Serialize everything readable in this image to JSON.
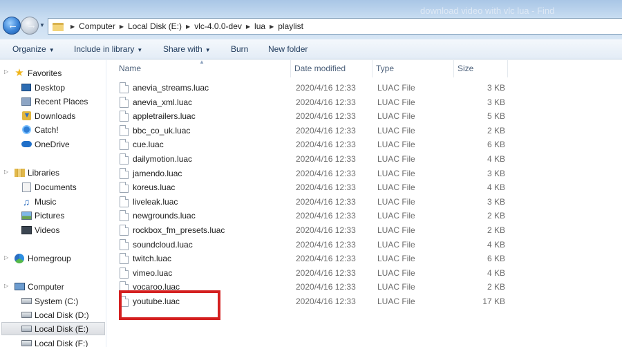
{
  "window": {
    "title": "download video with vlc lua - Find"
  },
  "nav_buttons": {
    "back": "←",
    "forward": "→",
    "recent": "▼"
  },
  "breadcrumb": [
    {
      "label": "Computer"
    },
    {
      "label": "Local Disk (E:)"
    },
    {
      "label": "vlc-4.0.0-dev"
    },
    {
      "label": "lua"
    },
    {
      "label": "playlist"
    }
  ],
  "breadcrumb_separator": "▶",
  "toolbar": {
    "dropdown_glyph": "▼",
    "organize": "Organize",
    "include_in_library": "Include in library",
    "share_with": "Share with",
    "burn": "Burn",
    "new_folder": "New folder"
  },
  "sidebar": {
    "expander_glyph": "▷",
    "favorites": {
      "label": "Favorites",
      "items": [
        "Desktop",
        "Recent Places",
        "Downloads",
        "Catch!",
        "OneDrive"
      ]
    },
    "libraries": {
      "label": "Libraries",
      "items": [
        "Documents",
        "Music",
        "Pictures",
        "Videos"
      ]
    },
    "homegroup": {
      "label": "Homegroup"
    },
    "computer": {
      "label": "Computer",
      "items": [
        "System (C:)",
        "Local Disk (D:)",
        "Local Disk (E:)",
        "Local Disk (F:)"
      ],
      "selected": "Local Disk (E:)"
    }
  },
  "icons": {
    "favorites": "star-icon",
    "desktop": "desktop-icon",
    "recent": "recent-places-icon",
    "downloads": "downloads-icon",
    "catch": "catch-icon",
    "onedrive": "onedrive-icon",
    "libraries": "libraries-icon",
    "documents": "documents-icon",
    "music": "music-icon",
    "pictures": "pictures-icon",
    "videos": "videos-icon",
    "homegroup": "homegroup-icon",
    "computer": "computer-icon",
    "drive": "drive-icon",
    "file": "file-icon"
  },
  "columns": {
    "name": "Name",
    "date_modified": "Date modified",
    "type": "Type",
    "size": "Size",
    "sort_glyph": "▲"
  },
  "files": [
    {
      "name": "anevia_streams.luac",
      "date": "2020/4/16 12:33",
      "type": "LUAC File",
      "size": "3 KB"
    },
    {
      "name": "anevia_xml.luac",
      "date": "2020/4/16 12:33",
      "type": "LUAC File",
      "size": "3 KB"
    },
    {
      "name": "appletrailers.luac",
      "date": "2020/4/16 12:33",
      "type": "LUAC File",
      "size": "5 KB"
    },
    {
      "name": "bbc_co_uk.luac",
      "date": "2020/4/16 12:33",
      "type": "LUAC File",
      "size": "2 KB"
    },
    {
      "name": "cue.luac",
      "date": "2020/4/16 12:33",
      "type": "LUAC File",
      "size": "6 KB"
    },
    {
      "name": "dailymotion.luac",
      "date": "2020/4/16 12:33",
      "type": "LUAC File",
      "size": "4 KB"
    },
    {
      "name": "jamendo.luac",
      "date": "2020/4/16 12:33",
      "type": "LUAC File",
      "size": "3 KB"
    },
    {
      "name": "koreus.luac",
      "date": "2020/4/16 12:33",
      "type": "LUAC File",
      "size": "4 KB"
    },
    {
      "name": "liveleak.luac",
      "date": "2020/4/16 12:33",
      "type": "LUAC File",
      "size": "3 KB"
    },
    {
      "name": "newgrounds.luac",
      "date": "2020/4/16 12:33",
      "type": "LUAC File",
      "size": "2 KB"
    },
    {
      "name": "rockbox_fm_presets.luac",
      "date": "2020/4/16 12:33",
      "type": "LUAC File",
      "size": "2 KB"
    },
    {
      "name": "soundcloud.luac",
      "date": "2020/4/16 12:33",
      "type": "LUAC File",
      "size": "4 KB"
    },
    {
      "name": "twitch.luac",
      "date": "2020/4/16 12:33",
      "type": "LUAC File",
      "size": "6 KB"
    },
    {
      "name": "vimeo.luac",
      "date": "2020/4/16 12:33",
      "type": "LUAC File",
      "size": "4 KB"
    },
    {
      "name": "vocaroo.luac",
      "date": "2020/4/16 12:33",
      "type": "LUAC File",
      "size": "2 KB"
    },
    {
      "name": "youtube.luac",
      "date": "2020/4/16 12:33",
      "type": "LUAC File",
      "size": "17 KB"
    }
  ],
  "highlighted_file": "youtube.luac",
  "colors": {
    "highlight_border": "#d42020",
    "toolbar_text": "#1e395b",
    "secondary_text": "#6d6d6d",
    "header_text": "#4c607a"
  }
}
